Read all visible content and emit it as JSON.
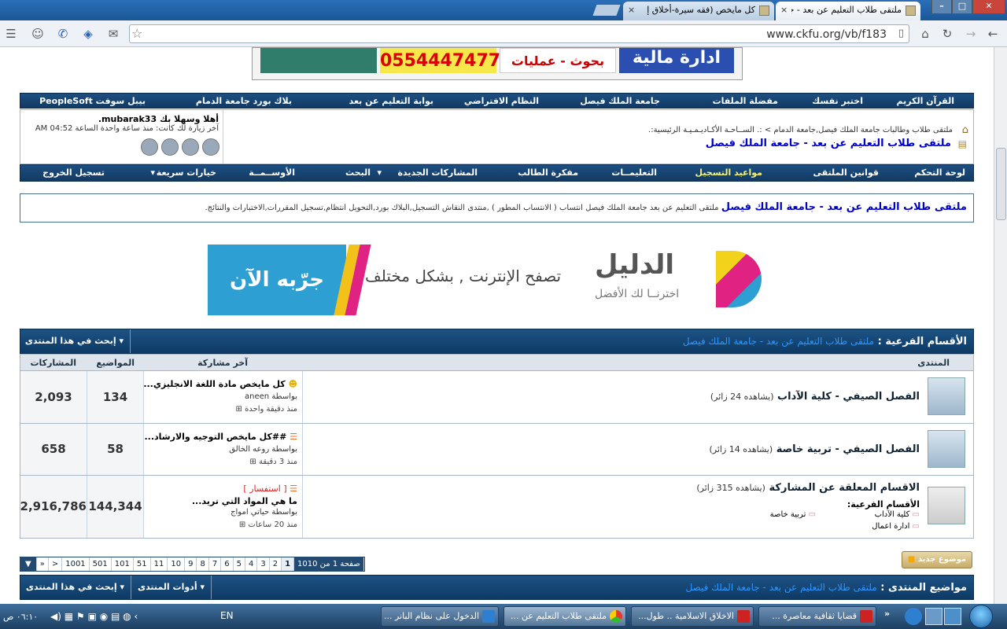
{
  "browser": {
    "tabs": [
      {
        "title": "ملتقى طلاب التعليم عن بعد - جا",
        "close": "×"
      },
      {
        "title": "كل مايخص (فقه سيرة-أخلاق إ",
        "close": "×"
      }
    ],
    "url": "www.ckfu.org/vb/f183"
  },
  "top_banner": {
    "phone": "0554447477",
    "research": "بحوث - عمليات",
    "finance": "ادارة مالية"
  },
  "topnav": [
    "القرآن الكريم",
    "اختبر نفسك",
    "مفضلة الملفات",
    "جامعة الملك فيصل",
    "النظام الافتراضي",
    "بوابة التعليم عن بعد",
    "بلاك بورد جامعة الدمام",
    "بيبل سوفت PeopleSoft"
  ],
  "breadcrumb": {
    "path": "ملتقى طلاب وطالبات جامعة الملك فيصل,جامعة الدمام > :. الســاحـة الأكـاديـمـيـة الرئيسية:.",
    "current": "ملتقى طلاب التعليم عن بعد - جامعة الملك فيصل"
  },
  "welcome": {
    "greeting": "أهلا وسهلا بك mubarak33.",
    "last_visit": "آخر زيارة لك كانت: منذ ساعة واحدة الساعة 04:52 AM"
  },
  "mainnav": [
    "لوحة التحكم",
    "قوانين الملتقى",
    "مواعيد التسجيل",
    "التعليمــات",
    "مفكرة الطالب",
    "المشاركات الجديدة",
    "البحث",
    "الأوســمــة",
    "خيارات سريعة",
    "تسجيل الخروج"
  ],
  "forum_desc": {
    "title": "ملتقى طلاب التعليم عن بعد - جامعة الملك فيصل",
    "text": " ملتقى التعليم عن بعد جامعة الملك فيصل انتساب ( الانتساب المطور ) ,منتدى النقاش التسجيل,البلاك بورد,التحويل انتظام,تسجيل المقررات,الاختبارات والنتائج."
  },
  "ad": {
    "brand": "الدليل",
    "slogan": "اخترنــا لك الأفضل",
    "tagline": "تصفح الإنترنت , بشكل مختلف",
    "cta": "جرّبه الآن"
  },
  "subforums_header": {
    "label": "الأقسام الفرعية :",
    "link": "ملتقى طلاب التعليم عن بعد - جامعة الملك فيصل",
    "search_btn": "إبحث في هذا المنتدى"
  },
  "columns": {
    "forum": "المنتدى",
    "last_post": "آخر مشاركة",
    "threads": "المواضيع",
    "posts": "المشاركات"
  },
  "forums": [
    {
      "name": "الفصل الصيفي - كلية الآداب",
      "viewers": "(يشاهده 24 زائر)",
      "last_title": "كل مايخص مادة اللغة الانجليزي...",
      "last_by": "بواسطة aneen",
      "last_time": "منذ دقيقة واحدة",
      "threads": "134",
      "posts": "2,093"
    },
    {
      "name": "الفصل الصيفي - تربية خاصة",
      "viewers": "(يشاهده 14 زائر)",
      "last_title": "##كل مايخص التوجيه والارشاد...",
      "last_by": "بواسطة روعه الخالق",
      "last_time": "منذ 3 دقيقة",
      "threads": "58",
      "posts": "658"
    },
    {
      "name": "الاقسام المعلقة عن المشاركة",
      "viewers": "(يشاهده 315 زائر)",
      "last_prefix": "[ استفسار ]",
      "last_title": "ما هي المواد التي تريد...",
      "last_by": "بواسطة حياتي امواج",
      "last_time": "منذ 20 ساعات",
      "threads": "144,344",
      "posts": "2,916,786",
      "subs_label": "الأقسام الفرعية:",
      "subs": [
        "كلية الآداب",
        "تربية خاصة",
        "ادارة اعمال"
      ]
    }
  ],
  "pager": [
    "صفحة 1 من 1010",
    "1",
    "2",
    "3",
    "4",
    "5",
    "6",
    "7",
    "8",
    "9",
    "10",
    "11",
    "51",
    "101",
    "501",
    "1001",
    ">",
    "»"
  ],
  "new_topic": "موضوع جديد",
  "topics_header": {
    "label": "مواضيع المنتدى :",
    "link": "ملتقى طلاب التعليم عن بعد - جامعة الملك فيصل",
    "tools_btn": "أدوات المنتدى",
    "search_btn": "إبحث في هذا المنتدى"
  },
  "taskbar": {
    "tasks": [
      "قضايا ثقافية معاصرة ...",
      "الاخلاق الاسلامية .. طول...",
      "ملتقى طلاب التعليم عن ...",
      "الدخول على نظام البانر ..."
    ],
    "lang": "EN",
    "clock": "٠٦:١٠ ص"
  },
  "colors": {
    "nav_dark": "#123a63",
    "link_blue": "#0000cc",
    "registration_yellow": "#f3f37a"
  }
}
